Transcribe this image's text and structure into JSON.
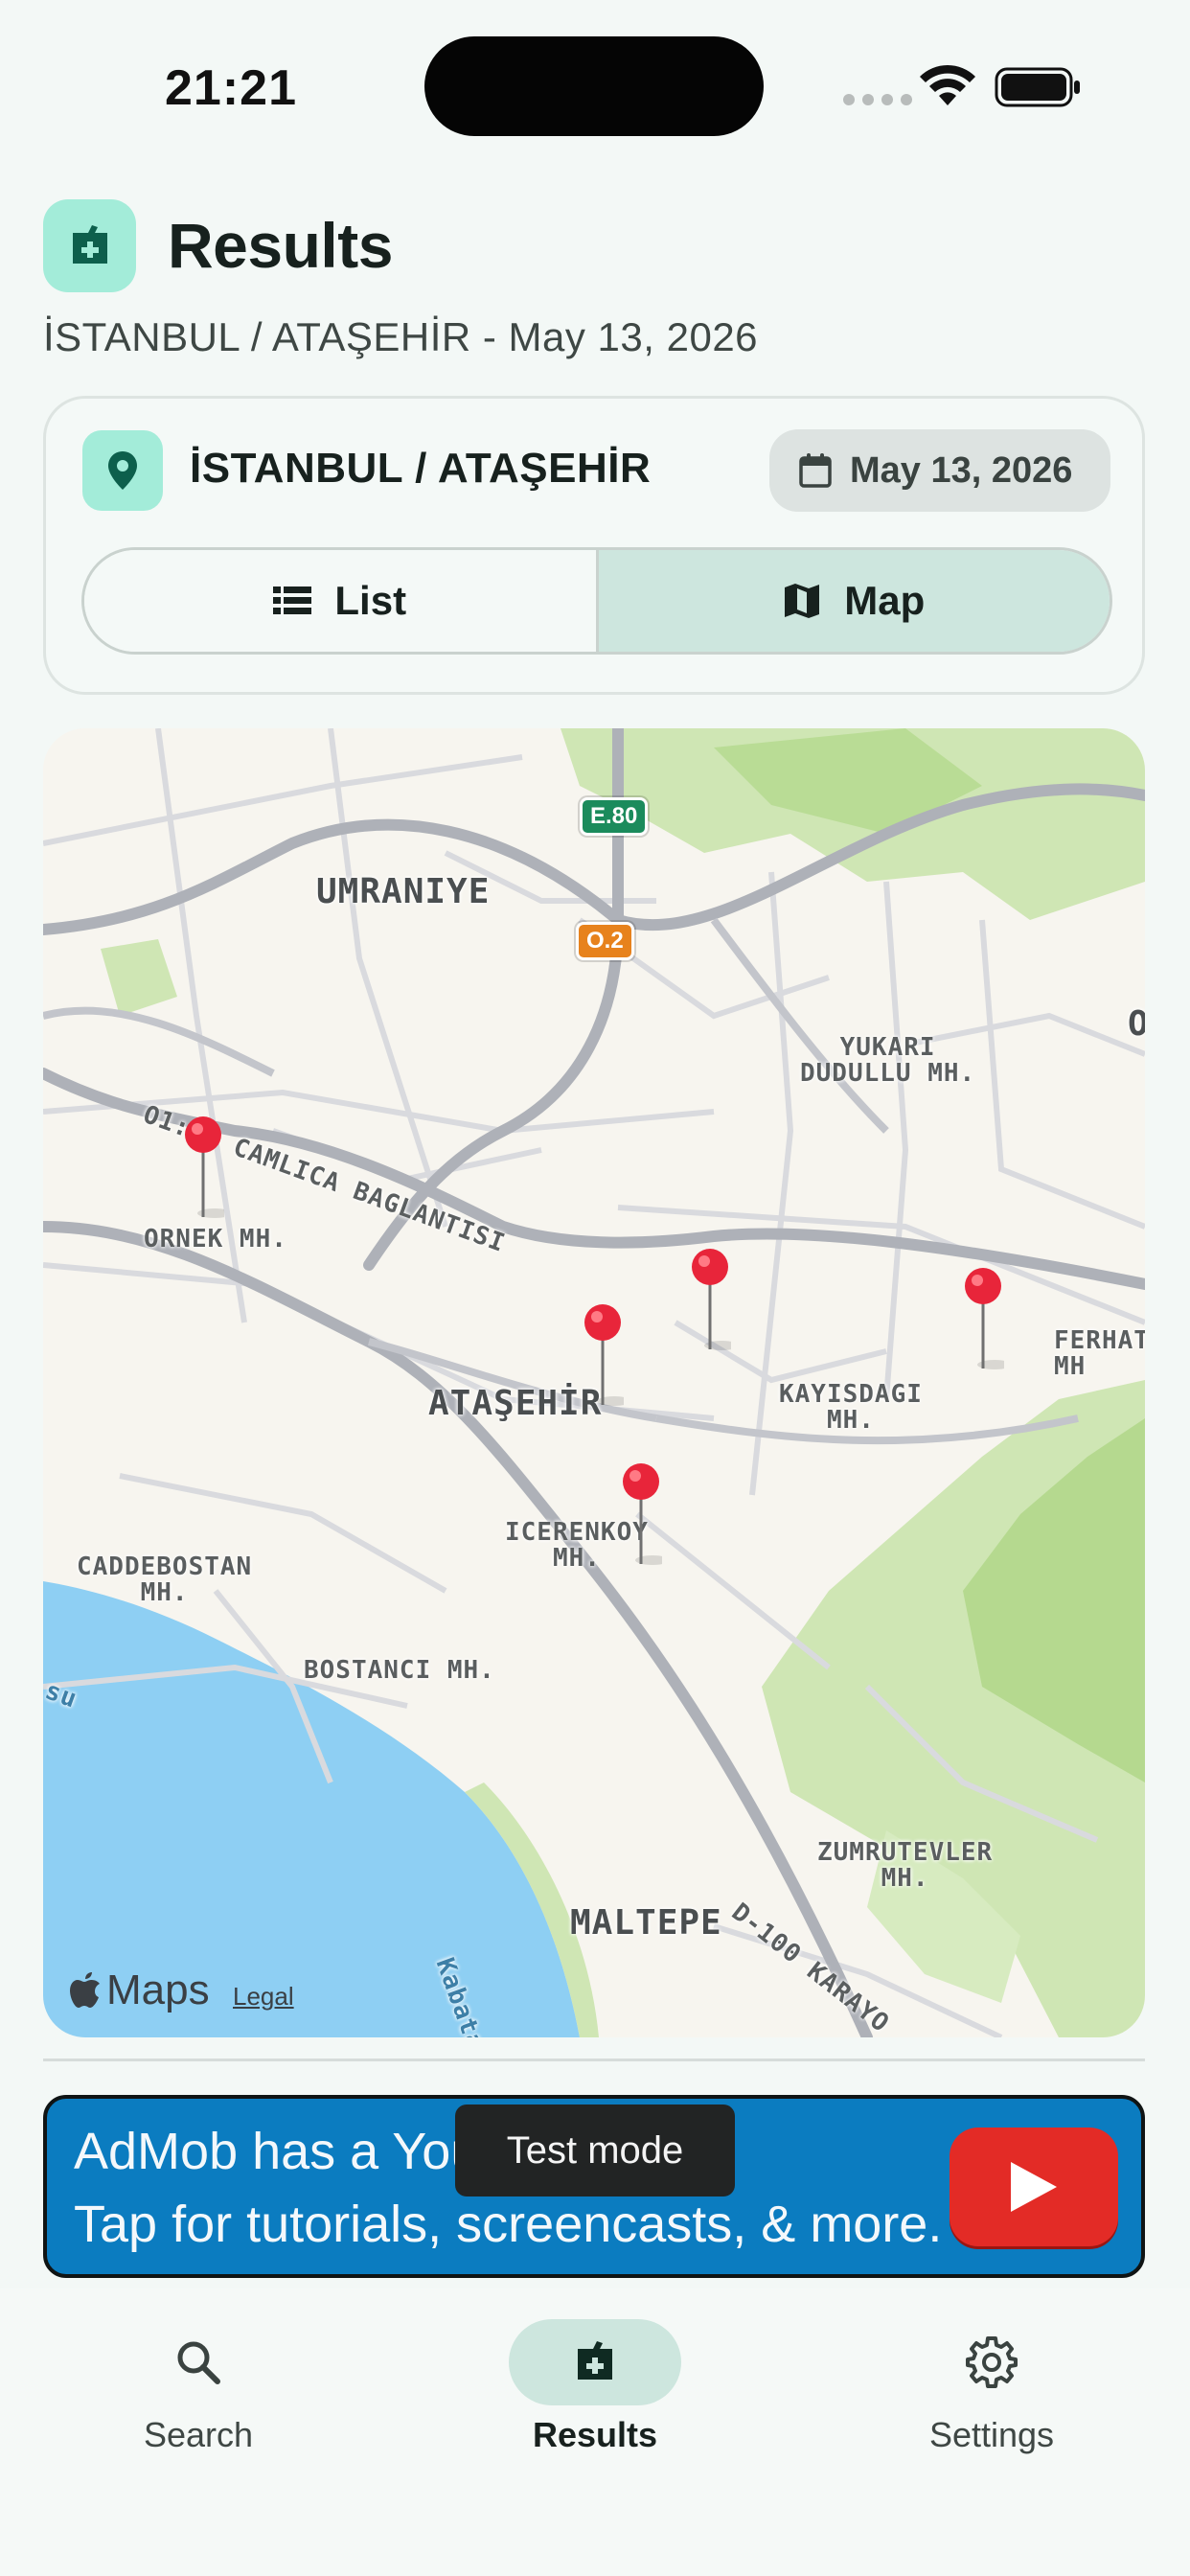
{
  "status_bar": {
    "time": "21:21"
  },
  "header": {
    "title": "Results",
    "subtitle": "İSTANBUL / ATAŞEHİR - May 13, 2026"
  },
  "filter": {
    "location": "İSTANBUL / ATAŞEHİR",
    "date": "May 13, 2026",
    "view_toggle": {
      "list_label": "List",
      "map_label": "Map",
      "selected": "Map"
    }
  },
  "map": {
    "labels": {
      "umraniye": "UMRANIYE",
      "yukari_dudullu": "YUKARI\nDUDULLU MH.",
      "camlica": "O1: 2 CAMLICA BAGLANTISI",
      "ornek": "ORNEK MH.",
      "atasehir": "ATAŞEHİR",
      "kayisdagi": "KAYISDAGI\nMH.",
      "ferhat": "FERHAT\nMH",
      "icerenkoy": "ICERENKOY\nMH.",
      "caddebostan": "CADDEBOSTAN\nMH.",
      "bostanci": "BOSTANCI MH.",
      "zumrutevler": "ZUMRUTEVLER\nMH.",
      "maltepe": "MALTEPE",
      "d100": "D-100 KARAYO",
      "kabata": "Kabata",
      "su": "su",
      "edge_o": "O"
    },
    "road_shields": {
      "e80": "E.80",
      "o2": "O.2"
    },
    "brand": "Maps",
    "legal": "Legal",
    "pin_count": 5
  },
  "ad": {
    "line1": "AdMob has a You",
    "line2": "Tap for tutorials, screencasts, & more.",
    "badge": "Test mode"
  },
  "bottom_nav": {
    "items": [
      {
        "label": "Search",
        "icon": "search-icon"
      },
      {
        "label": "Results",
        "icon": "results-icon",
        "active": true
      },
      {
        "label": "Settings",
        "icon": "gear-icon"
      }
    ]
  },
  "colors": {
    "accent": "#a3ecd9",
    "selected": "#cde6de",
    "pin": "#e8253a",
    "ad_blue": "#0b7cc0"
  }
}
